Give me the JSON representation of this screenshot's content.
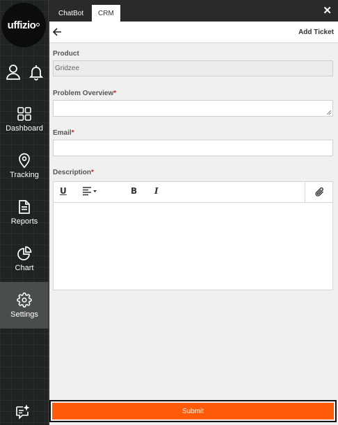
{
  "brand": {
    "logo_text": "uffizio"
  },
  "sidebar": {
    "icons": [
      {
        "icon": "user-icon"
      },
      {
        "icon": "bell-icon"
      }
    ],
    "items": [
      {
        "label": "Dashboard",
        "icon": "grid-icon"
      },
      {
        "label": "Tracking",
        "icon": "map-pin-icon"
      },
      {
        "label": "Reports",
        "icon": "document-icon"
      },
      {
        "label": "Chart",
        "icon": "pie-chart-icon"
      },
      {
        "label": "Settings",
        "icon": "gear-icon",
        "active": true
      }
    ],
    "bottom_icon": "chat-sparkle-icon"
  },
  "tabs": [
    {
      "label": "ChatBot",
      "active": false
    },
    {
      "label": "CRM",
      "active": true
    }
  ],
  "close_label": "✕",
  "panel": {
    "title": "Add Ticket",
    "product": {
      "label": "Product",
      "value": "Gridzee"
    },
    "problem_overview": {
      "label": "Problem Overview",
      "required_mark": "*",
      "value": ""
    },
    "email": {
      "label": "Email",
      "required_mark": "*",
      "value": ""
    },
    "description": {
      "label": "Description",
      "required_mark": "*",
      "toolbar": {
        "underline": "U",
        "bold": "B",
        "italic": "I"
      }
    },
    "submit_label": "Submit"
  },
  "colors": {
    "accent": "#ff5a0a",
    "sidebar_bg": "#1f2323",
    "required": "#d02020",
    "panel_bg": "#f0f0f0"
  }
}
